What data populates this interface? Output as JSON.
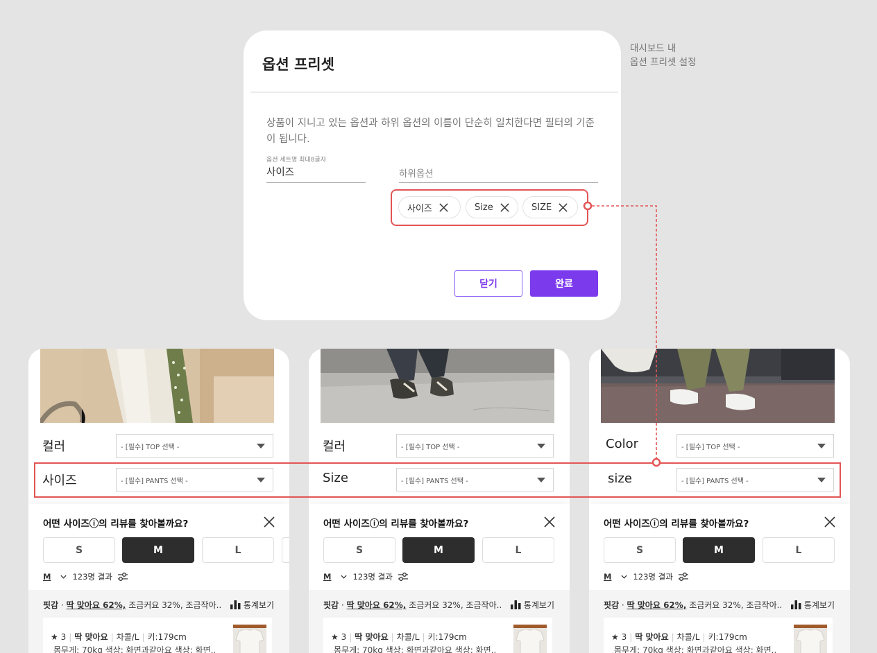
{
  "modal": {
    "title": "옵션 프리셋",
    "description": "상품이 지니고 있는 옵션과 하위 옵션의 이름이 단순히 일치한다면 필터의 기준이 됩니다.",
    "set_name_label": "옵션 세트명 최대8글자",
    "set_name_value": "사이즈",
    "sub_option_placeholder": "하위옵션",
    "tags": [
      "사이즈",
      "Size",
      "SIZE"
    ],
    "close_label": "닫기",
    "done_label": "완료"
  },
  "annotation": {
    "line1": "대시보드 내",
    "line2": "옵션 프리셋 설정"
  },
  "cards": [
    {
      "option1_label": "컬러",
      "option1_select": "- [필수] TOP 선택 -",
      "option2_label": "사이즈",
      "option2_select": "- [필수] PANTS 선택 -"
    },
    {
      "option1_label": "컬러",
      "option1_select": "- [필수] TOP 선택 -",
      "option2_label": "Size",
      "option2_select": "- [필수] PANTS 선택 -"
    },
    {
      "option1_label": "Color",
      "option1_select": "- [필수] TOP 선택 -",
      "option2_label": "size",
      "option2_select": "- [필수] PANTS 선택 -"
    }
  ],
  "review_panel": {
    "title": "어떤 사이즈ⓘ의 리뷰를 찾아볼까요?",
    "sizes": [
      "S",
      "M",
      "L"
    ],
    "selected_size": "M",
    "filter_size": "M",
    "result_count": "123명 결과",
    "fit_label": "핏감",
    "fit_main": "딱 맞아요 62%,",
    "fit_rest": "조금커요 32%,  조금작아..",
    "stats_label": "통계보기",
    "rating": "★ 3",
    "review_fit": "딱 맞아요",
    "review_color": "차콜/L",
    "review_height": "키:179cm",
    "review_line2": "몸무게: 70kg   색상: 화면과같아요   색상: 화면.."
  },
  "colors": {
    "accent": "#7c3aed",
    "highlight": "#e25555",
    "selected_size_bg": "#2d2d2d"
  }
}
